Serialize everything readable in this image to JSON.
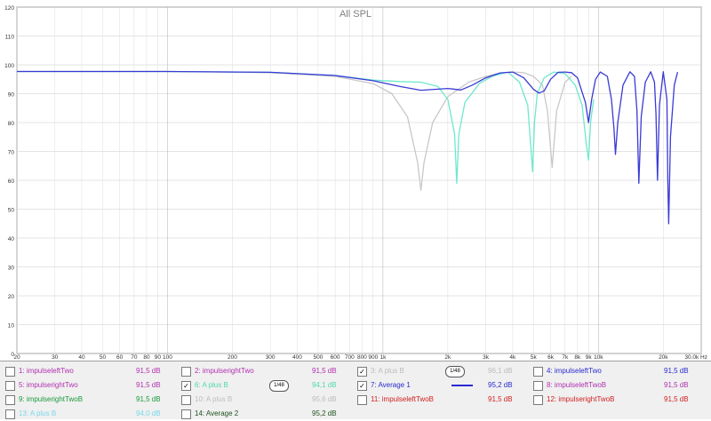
{
  "chart_data": {
    "type": "line",
    "title": "All SPL",
    "x_scale": "log",
    "xlim": [
      20,
      30000
    ],
    "ylim": [
      0,
      120
    ],
    "y_ticks": [
      0,
      10,
      20,
      30,
      40,
      50,
      60,
      70,
      80,
      90,
      100,
      110,
      120
    ],
    "x_tick_labels": [
      {
        "v": 20,
        "t": "20"
      },
      {
        "v": 30,
        "t": "30"
      },
      {
        "v": 40,
        "t": "40"
      },
      {
        "v": 50,
        "t": "50"
      },
      {
        "v": 60,
        "t": "60"
      },
      {
        "v": 70,
        "t": "70"
      },
      {
        "v": 80,
        "t": "80"
      },
      {
        "v": 90,
        "t": "90"
      },
      {
        "v": 100,
        "t": "100"
      },
      {
        "v": 200,
        "t": "200"
      },
      {
        "v": 300,
        "t": "300"
      },
      {
        "v": 400,
        "t": "400"
      },
      {
        "v": 500,
        "t": "500"
      },
      {
        "v": 600,
        "t": "600"
      },
      {
        "v": 700,
        "t": "700"
      },
      {
        "v": 800,
        "t": "800"
      },
      {
        "v": 900,
        "t": "900"
      },
      {
        "v": 1000,
        "t": "1k"
      },
      {
        "v": 2000,
        "t": "2k"
      },
      {
        "v": 3000,
        "t": "3k"
      },
      {
        "v": 4000,
        "t": "4k"
      },
      {
        "v": 5000,
        "t": "5k"
      },
      {
        "v": 6000,
        "t": "6k"
      },
      {
        "v": 7000,
        "t": "7k"
      },
      {
        "v": 8000,
        "t": "8k"
      },
      {
        "v": 9000,
        "t": "9k"
      },
      {
        "v": 10000,
        "t": "10k"
      },
      {
        "v": 20000,
        "t": "20k"
      },
      {
        "v": 30000,
        "t": "30.0k Hz"
      }
    ],
    "grid": true,
    "series": [
      {
        "name": "3: A plus B",
        "color": "#c8c8c8",
        "x": [
          20,
          100,
          300,
          600,
          900,
          1100,
          1300,
          1450,
          1500,
          1550,
          1700,
          2000,
          2500,
          3000,
          3500,
          4000,
          4500,
          5000,
          5500,
          5800,
          6100,
          6400,
          7000,
          7500
        ],
        "y": [
          97.7,
          97.7,
          97.3,
          96.0,
          93.5,
          90,
          82,
          66,
          56.5,
          66,
          80,
          89,
          94,
          96,
          97.2,
          97.5,
          97.3,
          96,
          93,
          84,
          64.5,
          84,
          94,
          96
        ]
      },
      {
        "name": "6: A plus B",
        "color": "#6ee8cc",
        "x": [
          20,
          100,
          300,
          600,
          900,
          1200,
          1500,
          1800,
          2000,
          2150,
          2200,
          2250,
          2400,
          2800,
          3200,
          3800,
          4300,
          4700,
          4950,
          5050,
          5200,
          5600,
          6200,
          7000,
          7800,
          8400,
          8800,
          9000,
          9200,
          9500
        ],
        "y": [
          97.7,
          97.7,
          97.4,
          96.3,
          94.7,
          94.2,
          94.0,
          92.5,
          88,
          76,
          59,
          76,
          87,
          93.5,
          96,
          97.5,
          94,
          86,
          63,
          80,
          90,
          95.5,
          97.5,
          97,
          93,
          86,
          72,
          67,
          80,
          88
        ]
      },
      {
        "name": "7: Average 1",
        "color": "#3a3ad6",
        "x": [
          20,
          100,
          300,
          600,
          900,
          1200,
          1500,
          2000,
          2300,
          2600,
          3000,
          3500,
          4000,
          4500,
          5000,
          5300,
          5600,
          6000,
          6500,
          7000,
          7500,
          8000,
          8700,
          9000,
          9300,
          9700,
          10200,
          11000,
          11500,
          11800,
          12000,
          12300,
          13000,
          14000,
          14700,
          15100,
          15400,
          15800,
          16500,
          17500,
          18200,
          18500,
          18800,
          19200,
          20000,
          20800,
          21000,
          21200,
          21600,
          22500,
          23300
        ],
        "y": [
          97.7,
          97.7,
          97.4,
          96.3,
          94.5,
          92.5,
          91.2,
          91.8,
          91.3,
          93,
          95.5,
          97.2,
          97.5,
          95.5,
          91.5,
          90.2,
          91,
          95,
          97.4,
          97.5,
          97.3,
          95.5,
          87,
          80,
          88,
          95,
          97.5,
          96,
          88,
          78,
          69,
          80,
          93,
          97.6,
          96,
          84,
          59,
          82,
          94,
          97.6,
          94,
          83,
          60,
          86,
          97.6,
          88,
          60,
          45,
          75,
          93,
          97.5
        ]
      }
    ]
  },
  "legend": {
    "columns": [
      [
        {
          "id": "1",
          "label": "1: impulseleftTwo",
          "value": "91,5 dB",
          "color": "#b030b0",
          "checked": false,
          "badge": ""
        },
        {
          "id": "5",
          "label": "5: impulserightTwo",
          "value": "91,5 dB",
          "color": "#b030b0",
          "checked": false,
          "badge": ""
        },
        {
          "id": "9",
          "label": "9: impulserightTwoB",
          "value": "91,5 dB",
          "color": "#1a9a3a",
          "checked": false,
          "badge": ""
        },
        {
          "id": "13",
          "label": "13: A plus B",
          "value": "94,0 dB",
          "color": "#7ad8ea",
          "checked": false,
          "badge": ""
        }
      ],
      [
        {
          "id": "2",
          "label": "2: impulserightTwo",
          "value": "91,5 dB",
          "color": "#b030b0",
          "checked": false,
          "badge": ""
        },
        {
          "id": "6",
          "label": "6: A plus B",
          "value": "94,1 dB",
          "color": "#50d8b0",
          "checked": true,
          "badge": "1/48"
        },
        {
          "id": "10",
          "label": "10: A plus B",
          "value": "95,6 dB",
          "color": "#bcbcbc",
          "checked": false,
          "badge": ""
        },
        {
          "id": "14",
          "label": "14: Average 2",
          "value": "95,2 dB",
          "color": "#205020",
          "checked": false,
          "badge": ""
        }
      ],
      [
        {
          "id": "3",
          "label": "3: A plus B",
          "value": "96,1 dB",
          "color": "#bcbcbc",
          "checked": true,
          "badge": "1/48"
        },
        {
          "id": "7",
          "label": "7: Average 1",
          "value": "95,2 dB",
          "color": "#2a2ad0",
          "checked": true,
          "badge": ""
        },
        {
          "id": "11",
          "label": "11: impulseleftTwoB",
          "value": "91,5 dB",
          "color": "#d02020",
          "checked": false,
          "badge": ""
        }
      ],
      [
        {
          "id": "4",
          "label": "4: impulseleftTwo",
          "value": "91,5 dB",
          "color": "#2a2ad0",
          "checked": false,
          "badge": ""
        },
        {
          "id": "8",
          "label": "8: impulseleftTwoB",
          "value": "91,5 dB",
          "color": "#b030b0",
          "checked": false,
          "badge": ""
        },
        {
          "id": "12",
          "label": "12: impulserightTwoB",
          "value": "91,5 dB",
          "color": "#d02020",
          "checked": false,
          "badge": ""
        }
      ]
    ]
  }
}
